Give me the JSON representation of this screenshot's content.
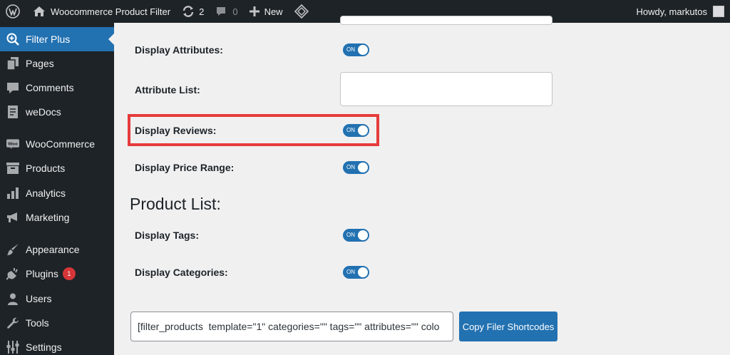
{
  "adminbar": {
    "site_name": "Woocommerce Product Filter",
    "updates_count": "2",
    "comments_count": "0",
    "new_label": "New",
    "greeting": "Howdy, markutos",
    "icons": [
      "wordpress-icon",
      "home-icon",
      "updates-icon",
      "comment-icon",
      "plus-icon",
      "plugin-diamond-icon"
    ]
  },
  "sidebar": {
    "items": [
      {
        "label": "Filter Plus",
        "icon": "magnifier-plus-icon",
        "current": true
      },
      {
        "label": "Pages",
        "icon": "pages-icon"
      },
      {
        "label": "Comments",
        "icon": "comments-icon"
      },
      {
        "label": "weDocs",
        "icon": "docs-icon"
      },
      {
        "label": "WooCommerce",
        "icon": "woo-icon"
      },
      {
        "label": "Products",
        "icon": "archive-icon"
      },
      {
        "label": "Analytics",
        "icon": "bar-chart-icon"
      },
      {
        "label": "Marketing",
        "icon": "megaphone-icon"
      },
      {
        "label": "Appearance",
        "icon": "brush-icon"
      },
      {
        "label": "Plugins",
        "icon": "plug-icon",
        "badge": "1"
      },
      {
        "label": "Users",
        "icon": "user-icon"
      },
      {
        "label": "Tools",
        "icon": "wrench-icon"
      },
      {
        "label": "Settings",
        "icon": "settings-icon"
      }
    ]
  },
  "settings": {
    "display_attributes": {
      "label": "Display Attributes:",
      "toggle": "ON"
    },
    "attribute_list": {
      "label": "Attribute List:",
      "value": ""
    },
    "display_reviews": {
      "label": "Display Reviews:",
      "toggle": "ON"
    },
    "display_price_range": {
      "label": "Display Price Range:",
      "toggle": "ON"
    }
  },
  "product_list": {
    "title": "Product List:",
    "display_tags": {
      "label": "Display Tags:",
      "toggle": "ON"
    },
    "display_categories": {
      "label": "Display Categories:",
      "toggle": "ON"
    }
  },
  "shortcode": {
    "value": "[filter_products  template=\"1\" categories=\"\" tags=\"\" attributes=\"\" colo",
    "button_label": "Copy Filer Shortcodes"
  },
  "colors": {
    "adminbar_bg": "#1d2327",
    "accent": "#2271b1",
    "highlight": "#e63b3b",
    "badge": "#d63638"
  }
}
